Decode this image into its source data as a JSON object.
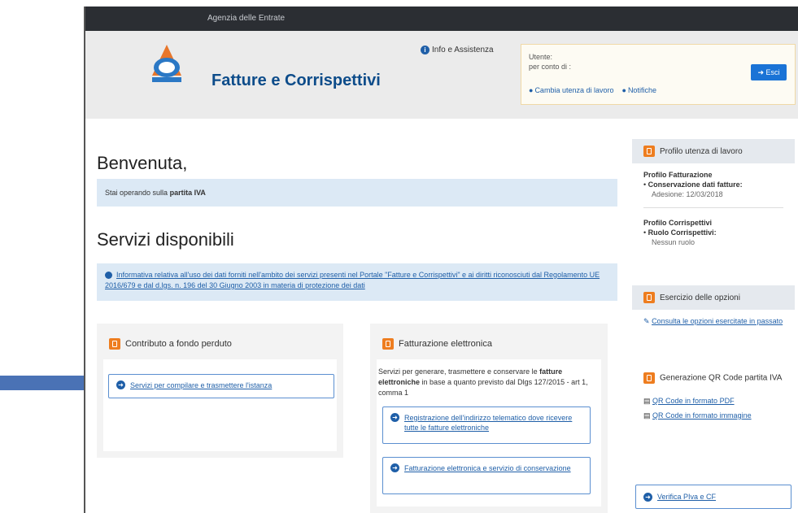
{
  "topbar": {
    "title": "Agenzia delle Entrate"
  },
  "header": {
    "app_title": "Fatture e Corrispettivi",
    "info_link": "Info e Assistenza",
    "user_label": "Utente:",
    "user_for": "per conto di :",
    "change_user_link": "Cambia utenza di lavoro",
    "notifications_link": "Notifiche",
    "exit_button": "Esci"
  },
  "main": {
    "welcome": "Benvenuta,",
    "notice_prefix": "Stai operando sulla",
    "notice_bold": "partita IVA",
    "section_title": "Servizi disponibili",
    "info_banner": "Informativa relativa all'uso dei dati forniti nell'ambito dei servizi presenti nel Portale \"Fatture e Corrispettivi\" e ai diritti riconosciuti dal Regolamento UE 2016/679 e dal d.lgs. n. 196 del 30 Giugno 2003 in materia di protezione dei dati"
  },
  "cards": {
    "contributo": {
      "title": "Contributo a fondo perduto",
      "link": "Servizi per compilare e trasmettere l'istanza"
    },
    "fatturazione": {
      "title": "Fatturazione elettronica",
      "desc_pre": "Servizi per generare, trasmettere e conservare le",
      "desc_bold": "fatture elettroniche",
      "desc_post": "in base a quanto previsto dal Dlgs 127/2015 - art 1, comma 1",
      "link1": "Registrazione dell'indirizzo telematico dove ricevere tutte le fatture elettroniche",
      "link2": "Fatturazione elettronica e servizio di conservazione"
    }
  },
  "sidebar": {
    "profile_title": "Profilo utenza di lavoro",
    "profilo_fatturazione": "Profilo Fatturazione",
    "conservazione": "Conservazione dati fatture:",
    "adesione": "Adesione: 12/03/2018",
    "profilo_corrispettivi": "Profilo Corrispettivi",
    "ruolo": "Ruolo Corrispettivi:",
    "nessun_ruolo": "Nessun ruolo",
    "opzioni_title": "Esercizio delle opzioni",
    "opzioni_link": "Consulta le opzioni esercitate in passato",
    "qr_title": "Generazione QR Code partita IVA",
    "qr_pdf": "QR Code in formato PDF",
    "qr_img": "QR Code in formato immagine",
    "verifica": "Verifica PIva e CF"
  },
  "colors": {
    "accent": "#1f5fa8",
    "orange": "#ee7d1f",
    "arrow": "#4a72b5"
  }
}
